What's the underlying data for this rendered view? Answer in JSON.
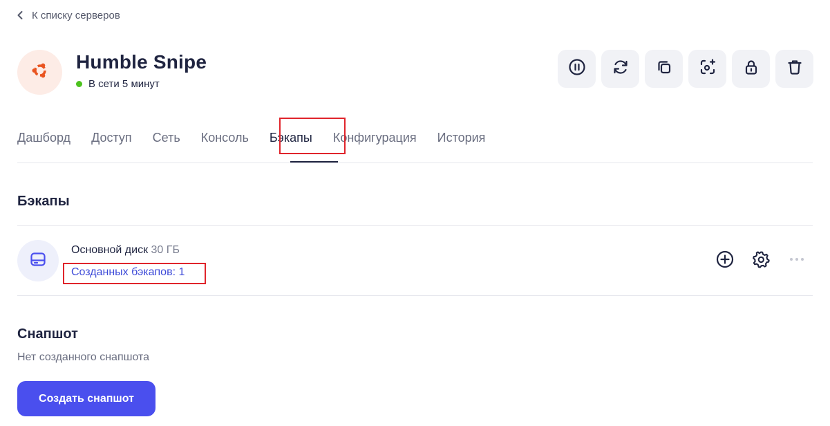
{
  "nav": {
    "back_label": "К списку серверов"
  },
  "server": {
    "name": "Humble Snipe",
    "status": "В сети 5 минут",
    "os_icon": "ubuntu-logo-icon",
    "status_color": "#4cc21e"
  },
  "actions": [
    {
      "icon": "pause-icon"
    },
    {
      "icon": "reboot-icon"
    },
    {
      "icon": "clone-icon"
    },
    {
      "icon": "screenshot-icon"
    },
    {
      "icon": "lock-icon"
    },
    {
      "icon": "trash-icon"
    }
  ],
  "tabs": [
    {
      "label": "Дашборд"
    },
    {
      "label": "Доступ"
    },
    {
      "label": "Сеть"
    },
    {
      "label": "Консоль"
    },
    {
      "label": "Бэкапы",
      "active": true
    },
    {
      "label": "Конфигурация"
    },
    {
      "label": "История"
    }
  ],
  "backups": {
    "title": "Бэкапы",
    "disk": {
      "name": "Основной диск",
      "size": "30 ГБ",
      "backups_count_label": "Созданных бэкапов: 1",
      "icon": "disk-icon"
    },
    "actions": [
      "add-icon",
      "settings-icon",
      "more-icon"
    ]
  },
  "snapshot": {
    "title": "Снапшот",
    "empty_text": "Нет созданного снапшота",
    "create_button": "Создать снапшот"
  },
  "colors": {
    "accent": "#4a4fee",
    "link": "#3d4ad8",
    "highlight": "#e0242b",
    "text": "#1f2440"
  }
}
